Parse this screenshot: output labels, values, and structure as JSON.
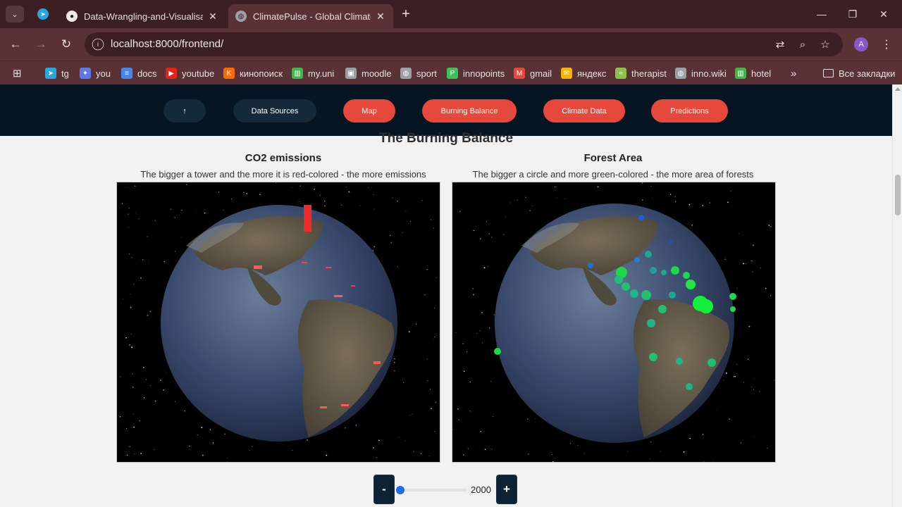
{
  "browser": {
    "tabs": [
      {
        "title": "Data-Wrangling-and-Visualisatio",
        "icon": "github-icon"
      },
      {
        "title": "ClimatePulse - Global Climate C",
        "icon": "globe-icon"
      }
    ],
    "url": "localhost:8000/frontend/",
    "avatar_letter": "A",
    "bookmarks": [
      {
        "label": "tg",
        "icon": "telegram-icon",
        "color": "#2aa6df"
      },
      {
        "label": "you",
        "icon": "sparkle-icon",
        "color": "#5b7ae6"
      },
      {
        "label": "docs",
        "icon": "docs-icon",
        "color": "#4a86e8"
      },
      {
        "label": "youtube",
        "icon": "youtube-icon",
        "color": "#e62117"
      },
      {
        "label": "кинопоиск",
        "icon": "kinopoisk-icon",
        "color": "#ff6a00"
      },
      {
        "label": "my.uni",
        "icon": "myuni-icon",
        "color": "#41b549"
      },
      {
        "label": "moodle",
        "icon": "moodle-icon",
        "color": "#9aa0a6"
      },
      {
        "label": "sport",
        "icon": "globe-icon",
        "color": "#9aa0a6"
      },
      {
        "label": "innopoints",
        "icon": "innopoints-icon",
        "color": "#3fbf5a"
      },
      {
        "label": "gmail",
        "icon": "gmail-icon",
        "color": "#e8453c"
      },
      {
        "label": "яндекс",
        "icon": "mail-icon",
        "color": "#f5b400"
      },
      {
        "label": "therapist",
        "icon": "therapist-icon",
        "color": "#8bc34a"
      },
      {
        "label": "inno.wiki",
        "icon": "globe-icon",
        "color": "#9aa0a6"
      },
      {
        "label": "hotel",
        "icon": "hotel-icon",
        "color": "#41b549"
      }
    ],
    "all_bookmarks": "Все закладки"
  },
  "nav": {
    "up_label": "↑",
    "buttons": [
      "Data Sources",
      "Map",
      "Burning Balance",
      "Climate Data",
      "Predictions"
    ]
  },
  "section": {
    "title": "The Burning Balance",
    "co2": {
      "title": "CO2 emissions",
      "description": "The bigger a tower and the more it is red-colored - the more emissions"
    },
    "forest": {
      "title": "Forest Area",
      "description": "The bigger a circle and more green-colored - the more area of forests"
    }
  },
  "year_slider": {
    "minus_label": "-",
    "plus_label": "+",
    "value": "2000"
  },
  "colors": {
    "accent_red": "#e6493b",
    "nav_dark": "#061521",
    "slider_blue": "#1a6fe8"
  }
}
